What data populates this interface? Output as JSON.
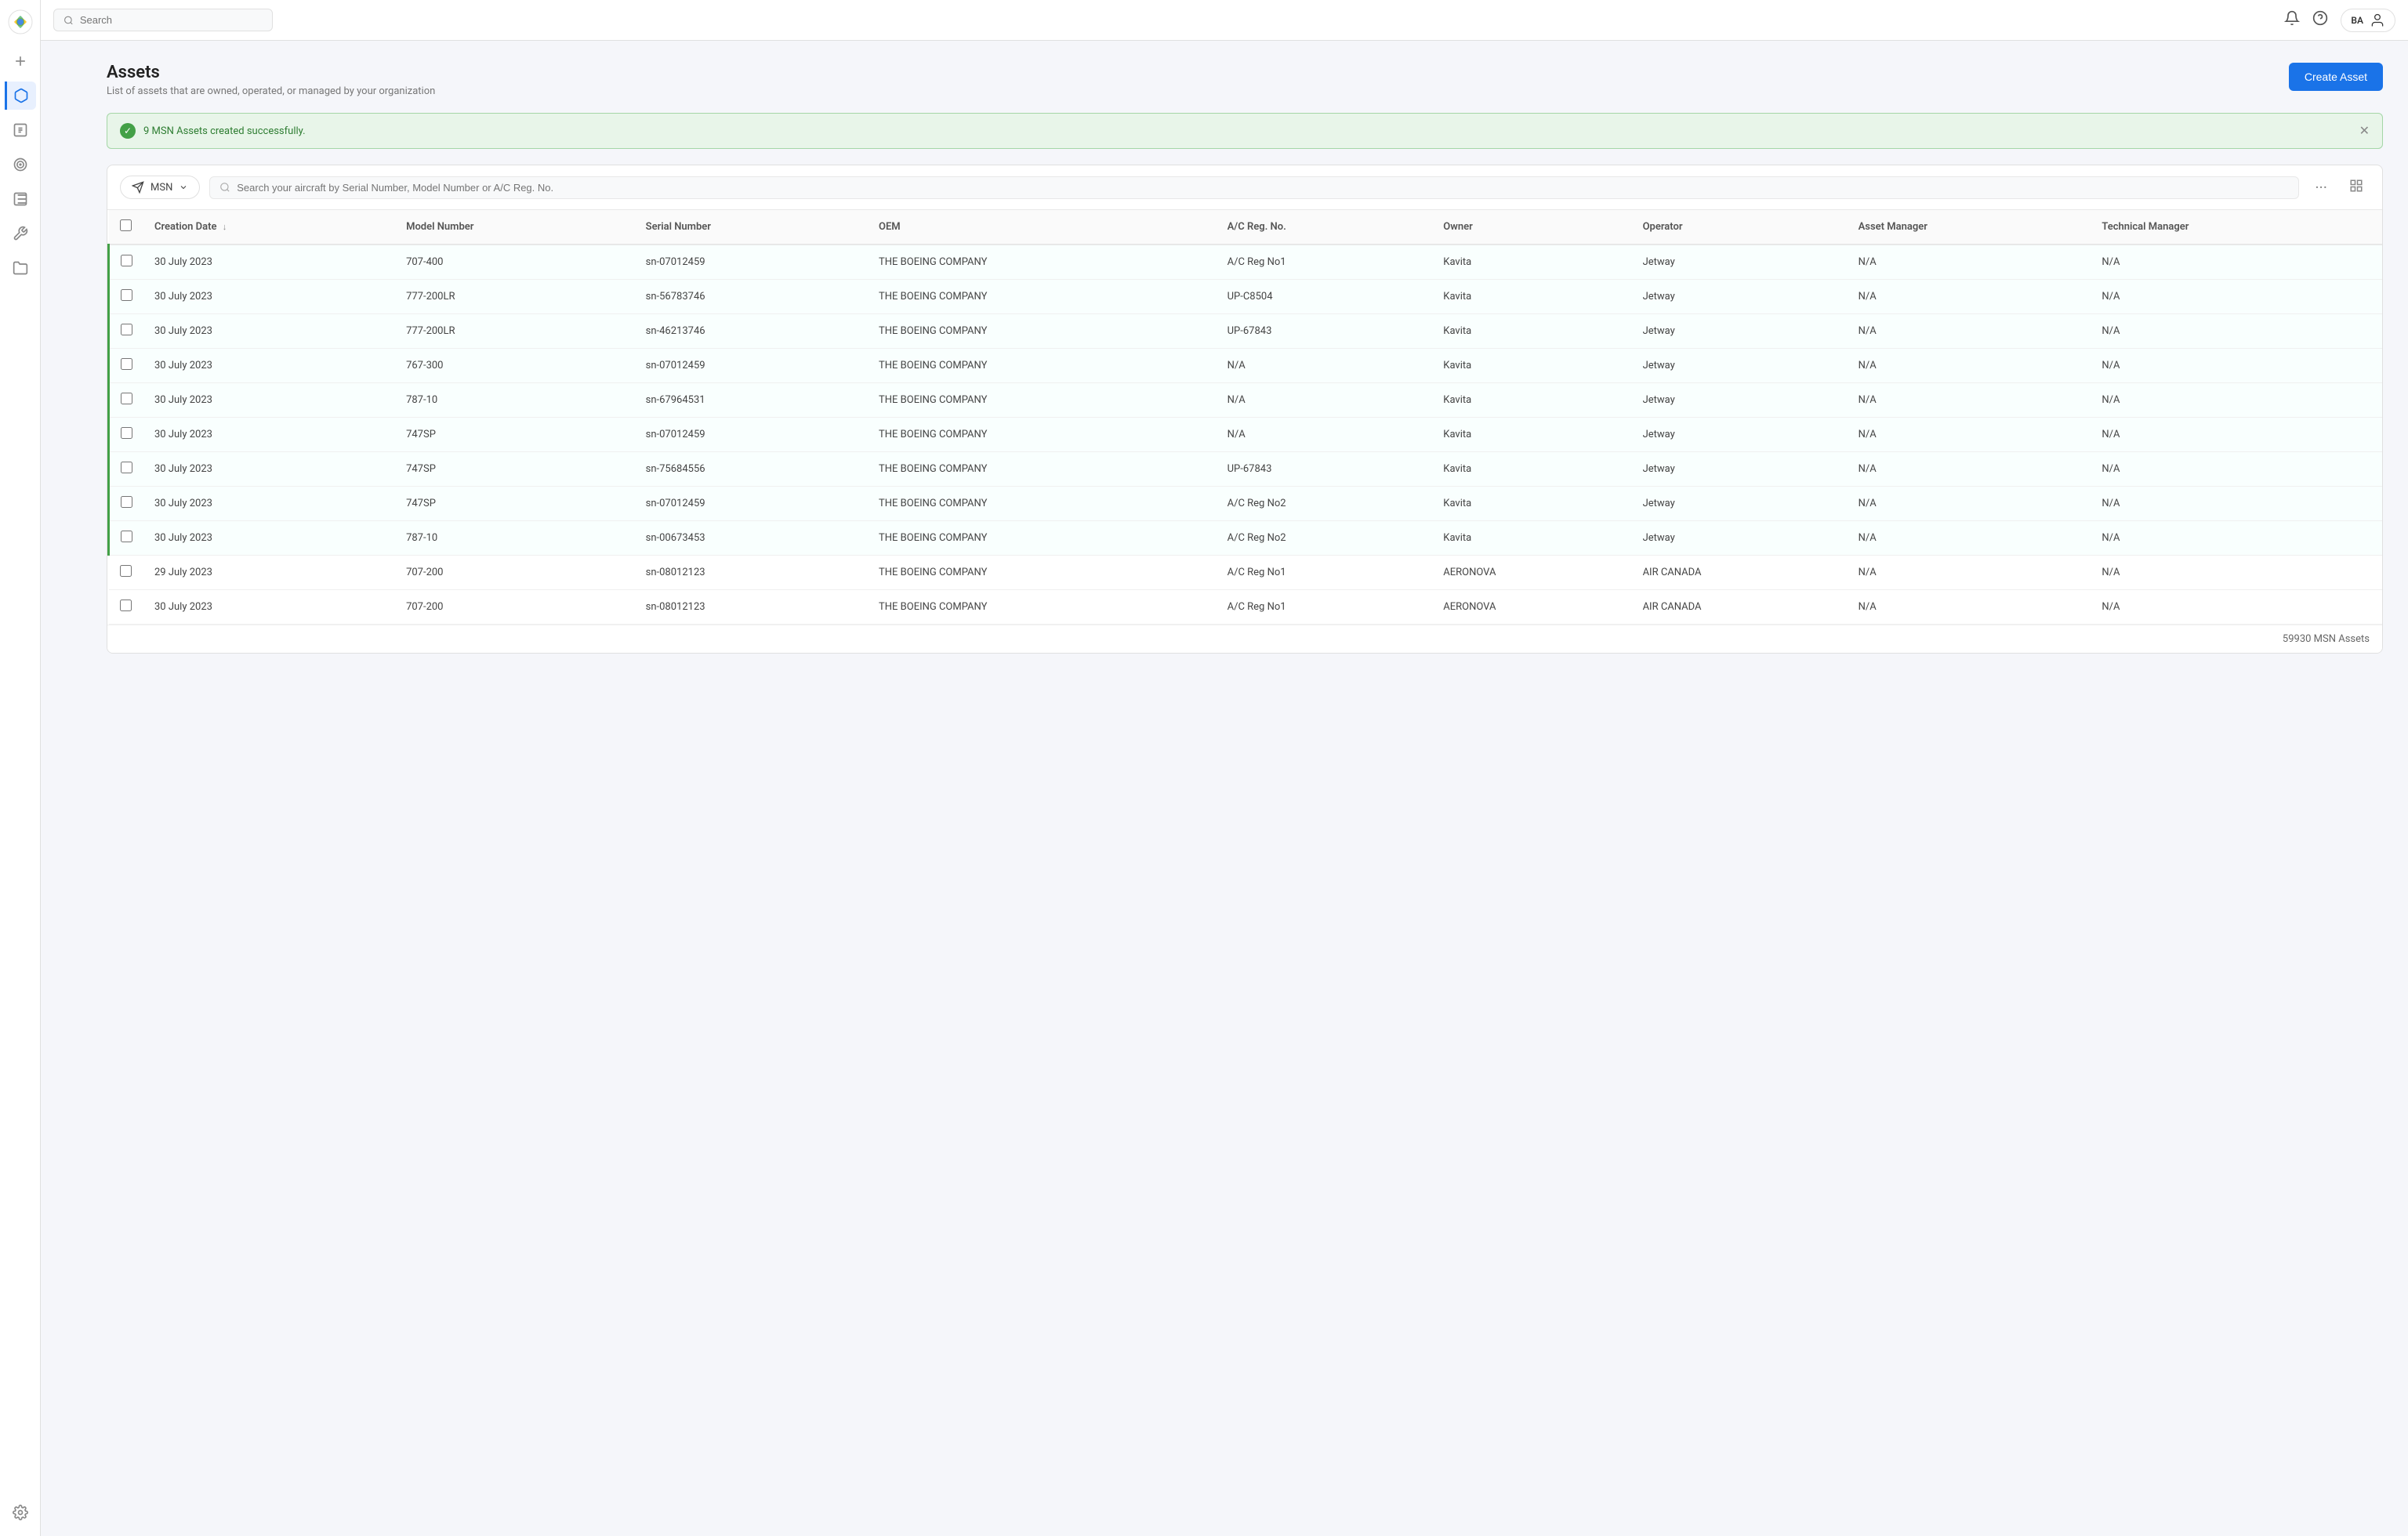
{
  "app": {
    "title": "Assets"
  },
  "topbar": {
    "search_placeholder": "Search",
    "user_initials": "BA"
  },
  "page": {
    "title": "Assets",
    "subtitle": "List of assets that are owned, operated, or managed by your organization",
    "create_button": "Create Asset"
  },
  "banner": {
    "message": "9 MSN Assets created successfully."
  },
  "filter": {
    "label": "MSN",
    "search_placeholder": "Search your aircraft by Serial Number, Model Number or A/C Reg. No."
  },
  "table": {
    "columns": [
      "Creation Date",
      "Model Number",
      "Serial Number",
      "OEM",
      "A/C Reg. No.",
      "Owner",
      "Operator",
      "Asset Manager",
      "Technical Manager"
    ],
    "footer": "59930 MSN Assets",
    "rows": [
      {
        "creation_date": "30 July 2023",
        "model_number": "707-400",
        "serial_number": "sn-07012459",
        "oem": "THE BOEING COMPANY",
        "ac_reg": "A/C Reg No1",
        "owner": "Kavita",
        "operator": "Jetway",
        "asset_manager": "N/A",
        "technical_manager": "N/A",
        "highlighted": true
      },
      {
        "creation_date": "30 July 2023",
        "model_number": "777-200LR",
        "serial_number": "sn-56783746",
        "oem": "THE BOEING COMPANY",
        "ac_reg": "UP-C8504",
        "owner": "Kavita",
        "operator": "Jetway",
        "asset_manager": "N/A",
        "technical_manager": "N/A",
        "highlighted": true
      },
      {
        "creation_date": "30 July 2023",
        "model_number": "777-200LR",
        "serial_number": "sn-46213746",
        "oem": "THE BOEING COMPANY",
        "ac_reg": "UP-67843",
        "owner": "Kavita",
        "operator": "Jetway",
        "asset_manager": "N/A",
        "technical_manager": "N/A",
        "highlighted": true
      },
      {
        "creation_date": "30 July 2023",
        "model_number": "767-300",
        "serial_number": "sn-07012459",
        "oem": "THE BOEING COMPANY",
        "ac_reg": "N/A",
        "owner": "Kavita",
        "operator": "Jetway",
        "asset_manager": "N/A",
        "technical_manager": "N/A",
        "highlighted": true
      },
      {
        "creation_date": "30 July 2023",
        "model_number": "787-10",
        "serial_number": "sn-67964531",
        "oem": "THE BOEING COMPANY",
        "ac_reg": "N/A",
        "owner": "Kavita",
        "operator": "Jetway",
        "asset_manager": "N/A",
        "technical_manager": "N/A",
        "highlighted": true
      },
      {
        "creation_date": "30 July 2023",
        "model_number": "747SP",
        "serial_number": "sn-07012459",
        "oem": "THE BOEING COMPANY",
        "ac_reg": "N/A",
        "owner": "Kavita",
        "operator": "Jetway",
        "asset_manager": "N/A",
        "technical_manager": "N/A",
        "highlighted": true
      },
      {
        "creation_date": "30 July 2023",
        "model_number": "747SP",
        "serial_number": "sn-75684556",
        "oem": "THE BOEING COMPANY",
        "ac_reg": "UP-67843",
        "owner": "Kavita",
        "operator": "Jetway",
        "asset_manager": "N/A",
        "technical_manager": "N/A",
        "highlighted": true
      },
      {
        "creation_date": "30 July 2023",
        "model_number": "747SP",
        "serial_number": "sn-07012459",
        "oem": "THE BOEING COMPANY",
        "ac_reg": "A/C Reg No2",
        "owner": "Kavita",
        "operator": "Jetway",
        "asset_manager": "N/A",
        "technical_manager": "N/A",
        "highlighted": true
      },
      {
        "creation_date": "30 July 2023",
        "model_number": "787-10",
        "serial_number": "sn-00673453",
        "oem": "THE BOEING COMPANY",
        "ac_reg": "A/C Reg No2",
        "owner": "Kavita",
        "operator": "Jetway",
        "asset_manager": "N/A",
        "technical_manager": "N/A",
        "highlighted": true
      },
      {
        "creation_date": "29 July 2023",
        "model_number": "707-200",
        "serial_number": "sn-08012123",
        "oem": "THE BOEING COMPANY",
        "ac_reg": "A/C Reg No1",
        "owner": "AERONOVA",
        "operator": "AIR CANADA",
        "asset_manager": "N/A",
        "technical_manager": "N/A",
        "highlighted": false
      },
      {
        "creation_date": "30 July 2023",
        "model_number": "707-200",
        "serial_number": "sn-08012123",
        "oem": "THE BOEING COMPANY",
        "ac_reg": "A/C Reg No1",
        "owner": "AERONOVA",
        "operator": "AIR CANADA",
        "asset_manager": "N/A",
        "technical_manager": "N/A",
        "highlighted": false
      }
    ]
  },
  "sidebar": {
    "items": [
      {
        "name": "plus",
        "label": "Add",
        "active": false
      },
      {
        "name": "plane",
        "label": "Assets",
        "active": true
      },
      {
        "name": "chart",
        "label": "Reports",
        "active": false
      },
      {
        "name": "target",
        "label": "Targets",
        "active": false
      },
      {
        "name": "clipboard",
        "label": "Tasks",
        "active": false
      },
      {
        "name": "tools",
        "label": "Tools",
        "active": false
      },
      {
        "name": "folder",
        "label": "Documents",
        "active": false
      },
      {
        "name": "settings",
        "label": "Settings",
        "active": false
      }
    ]
  }
}
